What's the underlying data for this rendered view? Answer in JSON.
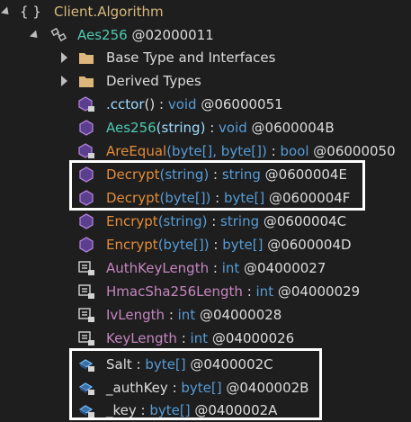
{
  "tree": {
    "namespace": {
      "braces": "{ }",
      "name": "Client.Algorithm"
    },
    "class": {
      "name": "Aes256",
      "token": " @02000011"
    },
    "folders": [
      {
        "label": "Base Type and Interfaces"
      },
      {
        "label": "Derived Types"
      }
    ],
    "members": [
      {
        "name": ".cctor",
        "sig": "()",
        "colon": " : ",
        "ret": "void",
        "token": " @06000051"
      },
      {
        "name": "Aes256",
        "sig": "(string)",
        "colon": " : ",
        "ret": "void",
        "token": " @0600004B"
      },
      {
        "name": "AreEqual",
        "sig": "(byte[], byte[])",
        "colon": " : ",
        "ret": "bool",
        "token": " @06000050"
      },
      {
        "name": "Decrypt",
        "sig": "(string)",
        "colon": " : ",
        "ret": "string",
        "token": " @0600004E"
      },
      {
        "name": "Decrypt",
        "sig": "(byte[])",
        "colon": " : ",
        "ret": "byte[]",
        "token": " @0600004F"
      },
      {
        "name": "Encrypt",
        "sig": "(string)",
        "colon": " : ",
        "ret": "string",
        "token": " @0600004C"
      },
      {
        "name": "Encrypt",
        "sig": "(byte[])",
        "colon": " : ",
        "ret": "byte[]",
        "token": " @0600004D"
      },
      {
        "name": "AuthKeyLength",
        "colon": " : ",
        "ret": "int",
        "token": " @04000027"
      },
      {
        "name": "HmacSha256Length",
        "colon": " : ",
        "ret": "int",
        "token": " @04000029"
      },
      {
        "name": "IvLength",
        "colon": " : ",
        "ret": "int",
        "token": " @04000028"
      },
      {
        "name": "KeyLength",
        "colon": " : ",
        "ret": "int",
        "token": " @04000026"
      },
      {
        "name": "Salt",
        "colon": " : ",
        "ret": "byte[]",
        "token": " @0400002C"
      },
      {
        "name": "_authKey",
        "colon": " : ",
        "ret": "byte[]",
        "token": " @0400002B"
      },
      {
        "name": "_key",
        "colon": " : ",
        "ret": "byte[]",
        "token": " @0400002A"
      }
    ]
  },
  "icons": [
    "namespace-icon",
    "class-icon",
    "folder-icon",
    "method-icon",
    "field-icon",
    "constant-icon"
  ],
  "colors": {
    "background": "#1e1e1e",
    "namespace": "#d7ba7d",
    "type": "#4ec9b0",
    "keyword": "#569cd6",
    "method": "#e38c3a",
    "field": "#c586c0",
    "highlight_box": "#ffffff"
  }
}
